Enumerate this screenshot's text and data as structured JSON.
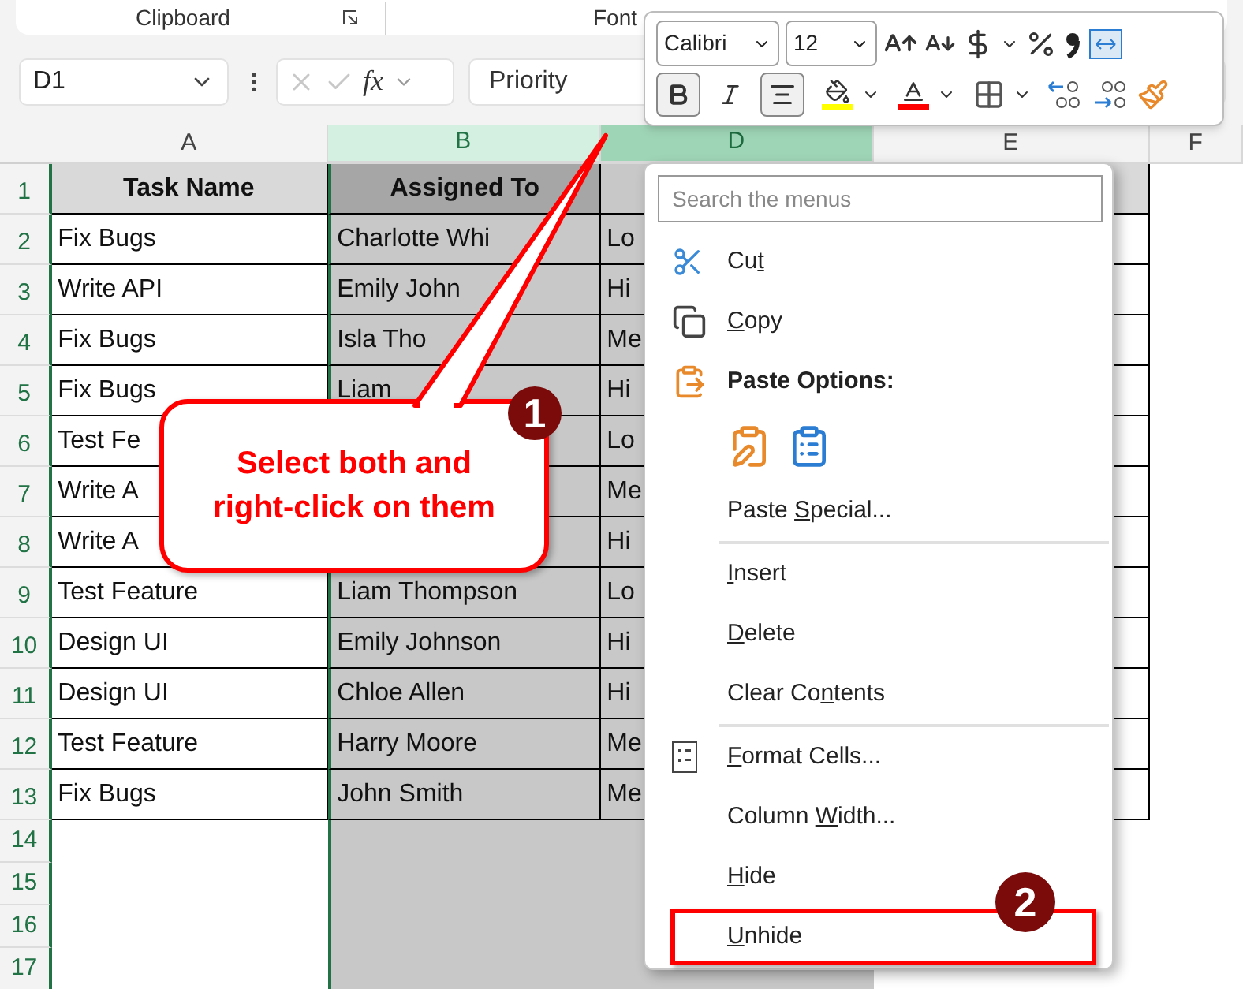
{
  "ribbon": {
    "groups": [
      {
        "label": "Clipboard"
      },
      {
        "label": "Font"
      }
    ]
  },
  "formula_bar": {
    "name_box": "D1",
    "function_label": "fx",
    "formula": "Priority"
  },
  "columns": [
    {
      "label": "A",
      "selected": false,
      "active": false
    },
    {
      "label": "B",
      "selected": true,
      "active": false
    },
    {
      "label": "D",
      "selected": true,
      "active": true
    },
    {
      "label": "E",
      "selected": false,
      "active": false
    },
    {
      "label": "F",
      "selected": false,
      "active": false
    }
  ],
  "rows": [
    {
      "number": "1",
      "kind": "header",
      "task": "Task Name",
      "assignee": "Assigned To"
    },
    {
      "number": "2",
      "kind": "data",
      "task": "Fix Bugs",
      "assignee": "Charlotte Whi",
      "priority": "Lo"
    },
    {
      "number": "3",
      "kind": "data",
      "task": "Write API",
      "assignee": "Emily John",
      "priority": "Hi"
    },
    {
      "number": "4",
      "kind": "data",
      "task": "Fix Bugs",
      "assignee": "Isla Tho",
      "priority": "Me"
    },
    {
      "number": "5",
      "kind": "data",
      "task": "Fix Bugs",
      "assignee": "Liam",
      "priority": "Hi"
    },
    {
      "number": "6",
      "kind": "data",
      "task": "Test Fe",
      "priority": "Lo"
    },
    {
      "number": "7",
      "kind": "data",
      "task": "Write A",
      "priority": "Me"
    },
    {
      "number": "8",
      "kind": "data",
      "task": "Write A",
      "priority": "Hi"
    },
    {
      "number": "9",
      "kind": "data",
      "task": "Test Feature",
      "assignee": "Liam Thompson",
      "priority": "Lo"
    },
    {
      "number": "10",
      "kind": "data",
      "task": "Design UI",
      "assignee": "Emily Johnson",
      "priority": "Hi"
    },
    {
      "number": "11",
      "kind": "data",
      "task": "Design UI",
      "assignee": "Chloe Allen",
      "priority": "Hi"
    },
    {
      "number": "12",
      "kind": "data",
      "task": "Test Feature",
      "assignee": "Harry Moore",
      "priority": "Me"
    },
    {
      "number": "13",
      "kind": "data",
      "task": "Fix Bugs",
      "assignee": "John Smith",
      "priority": "Me"
    },
    {
      "number": "14",
      "kind": "empty"
    },
    {
      "number": "15",
      "kind": "empty"
    },
    {
      "number": "16",
      "kind": "empty"
    },
    {
      "number": "17",
      "kind": "empty"
    }
  ],
  "callout": {
    "text": "Select both and right-click on them",
    "badge": "1"
  },
  "mini_toolbar": {
    "font": "Calibri",
    "size": "12",
    "bold": true,
    "italic": false,
    "align_center": true
  },
  "context_menu": {
    "search": {
      "placeholder": "Search the menus"
    },
    "items": [
      {
        "kind": "cut",
        "pre": "Cu",
        "key": "t"
      },
      {
        "kind": "copy",
        "key": "C",
        "post": "opy"
      },
      {
        "kind": "heading",
        "post": "Paste Options:"
      },
      {
        "kind": "paste"
      },
      {
        "kind": "command",
        "pre": "Paste ",
        "key": "S",
        "post": "pecial..."
      },
      {
        "kind": "separator"
      },
      {
        "kind": "command",
        "key": "I",
        "post": "nsert"
      },
      {
        "kind": "command",
        "key": "D",
        "post": "elete"
      },
      {
        "kind": "command",
        "pre": "Clear Co",
        "key": "n",
        "post": "tents"
      },
      {
        "kind": "separator"
      },
      {
        "kind": "format",
        "key": "F",
        "post": "ormat Cells..."
      },
      {
        "kind": "command",
        "pre": "Column ",
        "key": "W",
        "post": "idth..."
      },
      {
        "kind": "command",
        "key": "H",
        "post": "ide"
      },
      {
        "kind": "command",
        "key": "U",
        "post": "nhide",
        "badge": "2"
      }
    ]
  }
}
